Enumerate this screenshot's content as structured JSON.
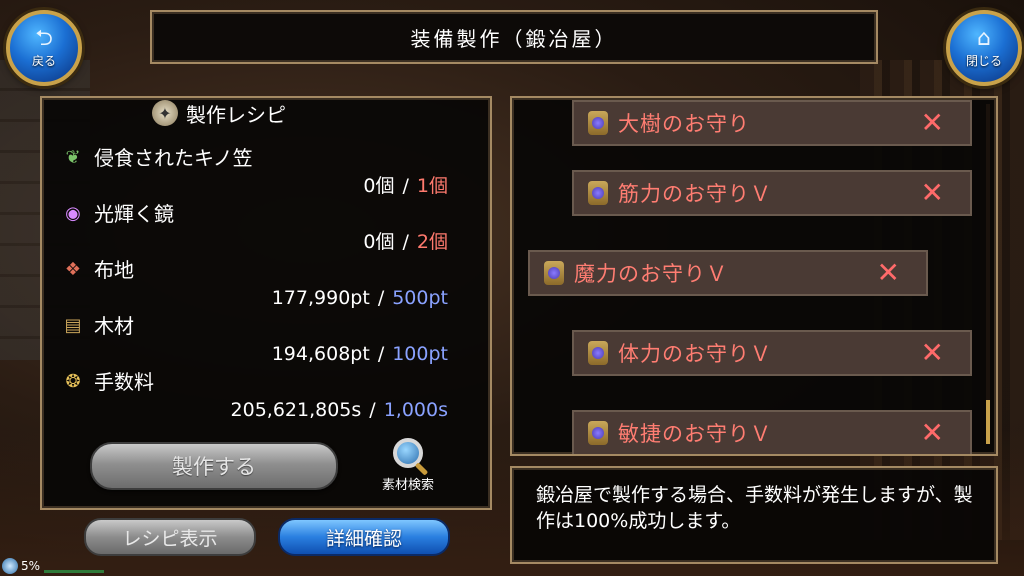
{
  "header": {
    "title": "装備製作（鍛冶屋）"
  },
  "nav": {
    "back": {
      "label": "戻る",
      "icon": "back-arrow-icon"
    },
    "close": {
      "label": "閉じる",
      "icon": "home-icon"
    }
  },
  "recipe": {
    "title": "製作レシピ",
    "materials": [
      {
        "name": "侵食されたキノ笠",
        "have": "0個",
        "need": "1個",
        "need_color": "red",
        "icon": "mushroom-icon"
      },
      {
        "name": "光輝く鏡",
        "have": "0個",
        "need": "2個",
        "need_color": "red",
        "icon": "mirror-orb-icon"
      },
      {
        "name": "布地",
        "have": "177,990pt",
        "need": "500pt",
        "need_color": "blue",
        "icon": "cloth-icon"
      },
      {
        "name": "木材",
        "have": "194,608pt",
        "need": "100pt",
        "need_color": "blue",
        "icon": "wood-icon"
      },
      {
        "name": "手数料",
        "have": "205,621,805s",
        "need": "1,000s",
        "need_color": "blue",
        "icon": "coins-icon"
      }
    ],
    "separator": "/",
    "craft_label": "製作する",
    "search_label": "素材検索"
  },
  "buttons": {
    "recipe_view": "レシピ表示",
    "detail_check": "詳細確認"
  },
  "status": {
    "percent": "5%"
  },
  "items": [
    {
      "name": "大樹のお守り",
      "mark": "✕",
      "selected": false
    },
    {
      "name": "筋力のお守りＶ",
      "mark": "✕",
      "selected": false
    },
    {
      "name": "魔力のお守りＶ",
      "mark": "✕",
      "selected": true
    },
    {
      "name": "体力のお守りＶ",
      "mark": "✕",
      "selected": false
    },
    {
      "name": "敏捷のお守りＶ",
      "mark": "✕",
      "selected": false
    }
  ],
  "message": "鍛冶屋で製作する場合、手数料が発生しますが、製作は100%成功します。",
  "colors": {
    "need_red": "#ff7a6e",
    "need_blue": "#8aa2ff",
    "frame_gold": "#a58a63",
    "item_name": "#ff7d72"
  }
}
